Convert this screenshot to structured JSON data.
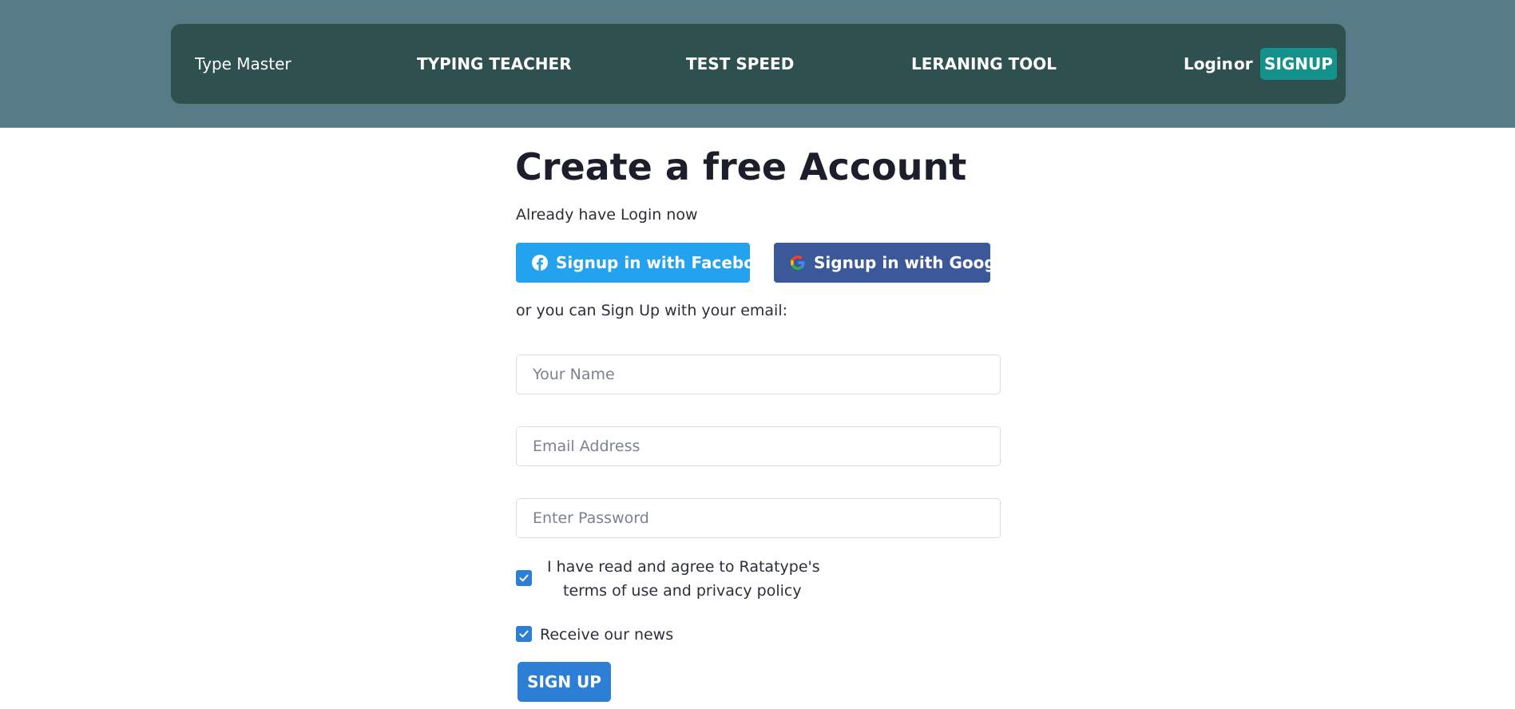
{
  "nav": {
    "brand": "Type Master",
    "links": [
      "TYPING TEACHER",
      "TEST SPEED",
      "LERANING TOOL"
    ],
    "login_label": "Login",
    "or_label": "or",
    "signup_label": "SIGNUP"
  },
  "main": {
    "title": "Create a free Account",
    "already_text": "Already have Login now",
    "facebook_button": "Signup in with Facebook",
    "google_button": "Signup in with Google",
    "or_email_text": "or you can Sign Up with your email:",
    "name_placeholder": "Your Name",
    "email_placeholder": "Email Address",
    "password_placeholder": "Enter Password",
    "terms_line1": "I have read and agree to Ratatype's",
    "terms_line2": "terms of use and privacy policy",
    "terms_checked": true,
    "news_label": "Receive our news",
    "news_checked": true,
    "submit_label": "SIGN UP"
  },
  "icons": {
    "facebook": "facebook-icon",
    "google": "google-icon",
    "checkmark": "checkmark-icon"
  },
  "colors": {
    "header_bg": "#587c87",
    "navbar_bg": "#2e504f",
    "signup_top_bg": "#14918a",
    "facebook_bg": "#23a2ef",
    "google_bg": "#3b5998",
    "primary": "#2d7fd6"
  }
}
